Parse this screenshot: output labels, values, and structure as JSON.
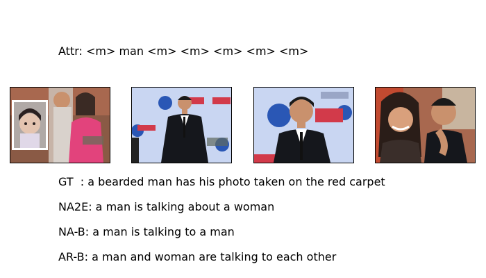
{
  "attr_line": "Attr: <m> man <m> <m> <m> <m> <m>",
  "frames": [
    {
      "icon": "photo-girl-and-woman"
    },
    {
      "icon": "photo-man-red-carpet"
    },
    {
      "icon": "photo-man-smiling-backdrop"
    },
    {
      "icon": "photo-couple-smiling"
    }
  ],
  "captions": {
    "gt": "GT  : a bearded man has his photo taken on the red carpet",
    "na2e": "NA2E: a man is talking about a woman",
    "nab": "NA-B: a man is talking to a man",
    "arb": "AR-B: a man and woman are talking to each other"
  },
  "colors": {
    "backdrop_blue": "#c9d6f2",
    "backdrop_logo": "#2a57b5",
    "filmfare_red": "#d23a4a",
    "suit": "#15171c",
    "skin": "#c9916d",
    "pink_dress": "#e2437c",
    "warm_bg": "#a8684f"
  }
}
